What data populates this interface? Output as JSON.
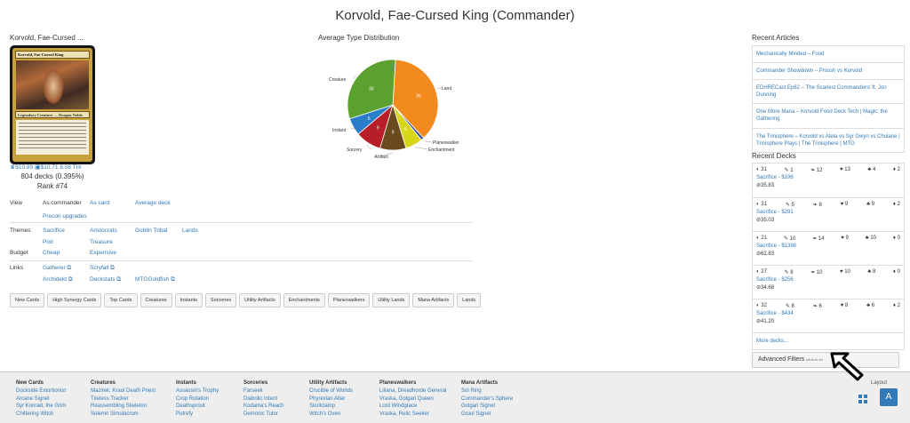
{
  "page": {
    "title": "Korvold, Fae-Cursed King (Commander)"
  },
  "card": {
    "name": "Korvold, Fae-Cursed ...",
    "image_title": "Korvold, Fae-Cursed King",
    "image_type": "Legendary Creature — Dragon Noble",
    "price1": "$10.99",
    "price2": "$10.71",
    "price3": "8.08 TIX",
    "decks": "804 decks (0.395%)",
    "rank": "Rank #74"
  },
  "chart_data": {
    "type": "pie",
    "title": "Average Type Distribution",
    "categories": [
      "Land",
      "Planeswalker",
      "Enchantment",
      "Artifact",
      "Sorcery",
      "Instant",
      "Creature"
    ],
    "values": [
      36,
      1,
      6,
      9,
      9,
      6,
      30
    ],
    "colors": [
      "#f28a1e",
      "#2b4a8a",
      "#d8d61a",
      "#6b4a1e",
      "#b81e28",
      "#2a7dc9",
      "#5aa130"
    ]
  },
  "info": {
    "view_label": "View",
    "view_items": [
      "As commander",
      "As card",
      "Average deck",
      "Precon upgrades"
    ],
    "themes_label": "Themes",
    "themes_items": [
      "Sacrifice",
      "Aristocrats",
      "Goblin Tribal",
      "Lands",
      "Pod",
      "Treasure"
    ],
    "budget_label": "Budget",
    "budget_items": [
      "Cheap",
      "Expensive"
    ],
    "links_label": "Links",
    "links_items": [
      "Gatherer",
      "Scryfall",
      "Archidekt",
      "Deckstats",
      "MTGGoldfish"
    ]
  },
  "buttons": [
    "New Cards",
    "High Synergy Cards",
    "Top Cards",
    "Creatures",
    "Instants",
    "Sorceries",
    "Utility Artifacts",
    "Enchantments",
    "Planeswalkers",
    "Utility Lands",
    "Mana Artifacts",
    "Lands"
  ],
  "articles": {
    "heading": "Recent Articles",
    "items": [
      "Mechanically Minded – Food",
      "Commander Showdown – Prossh vs Korvold",
      "EDHRECast Ep62 – The Scariest Commanders! ft. Jon Dunning",
      "One More Mana – Korvold Food Deck Tech | Magic: the Gathering",
      "The Trinisphere – Korvold vs Atela vs Syr Gwyn vs Chulane | Trinisphere Plays | The Trinisphere | MTG"
    ]
  },
  "decks": {
    "heading": "Recent Decks",
    "items": [
      {
        "s": [
          "31",
          "1",
          "12",
          "13",
          "4",
          "2"
        ],
        "name": "Sacrifice - $196",
        "price": "35.83"
      },
      {
        "s": [
          "31",
          "5",
          "8",
          "9",
          "9",
          "2"
        ],
        "name": "Sacrifice - $291",
        "price": "35.03"
      },
      {
        "s": [
          "21",
          "10",
          "14",
          "9",
          "10",
          "0"
        ],
        "name": "Sacrifice - $1398",
        "price": "62.83"
      },
      {
        "s": [
          "27",
          "8",
          "10",
          "10",
          "8",
          "0"
        ],
        "name": "Sacrifice - $256",
        "price": "34.68"
      },
      {
        "s": [
          "32",
          "8",
          "6",
          "8",
          "6",
          "2"
        ],
        "name": "Sacrifice - $434",
        "price": "41.20"
      }
    ],
    "more": "More decks..."
  },
  "advanced": {
    "label": "Advanced Filters",
    "note": "(click to ex"
  },
  "footer": {
    "columns": [
      {
        "h": "New Cards",
        "items": [
          "Dockside Extortionist",
          "Arcane Signet",
          "Syr Konrad, the Grim",
          "Chittering Witch"
        ]
      },
      {
        "h": "Creatures",
        "items": [
          "Mazirek, Kraul Death Priest",
          "Tireless Tracker",
          "Reassembling Skeleton",
          "Solemn Simulacrum"
        ]
      },
      {
        "h": "Instants",
        "items": [
          "Assassin's Trophy",
          "Crop Rotation",
          "Deathsprout",
          "Putrefy"
        ]
      },
      {
        "h": "Sorceries",
        "items": [
          "Farseek",
          "Diabolic Intent",
          "Kodama's Reach",
          "Demonic Tutor"
        ]
      },
      {
        "h": "Utility Artifacts",
        "items": [
          "Crucible of Worlds",
          "Phyrexian Altar",
          "Skullclamp",
          "Witch's Oven"
        ]
      },
      {
        "h": "Planeswalkers",
        "items": [
          "Liliana, Dreadhorde General",
          "Vraska, Golgari Queen",
          "Lord Windgrace",
          "Vraska, Relic Seeker"
        ]
      },
      {
        "h": "Mana Artifacts",
        "items": [
          "Sol Ring",
          "Commander's Sphere",
          "Golgari Signet",
          "Gruul Signet"
        ]
      }
    ],
    "layout_label": "Layout",
    "a_label": "A"
  }
}
